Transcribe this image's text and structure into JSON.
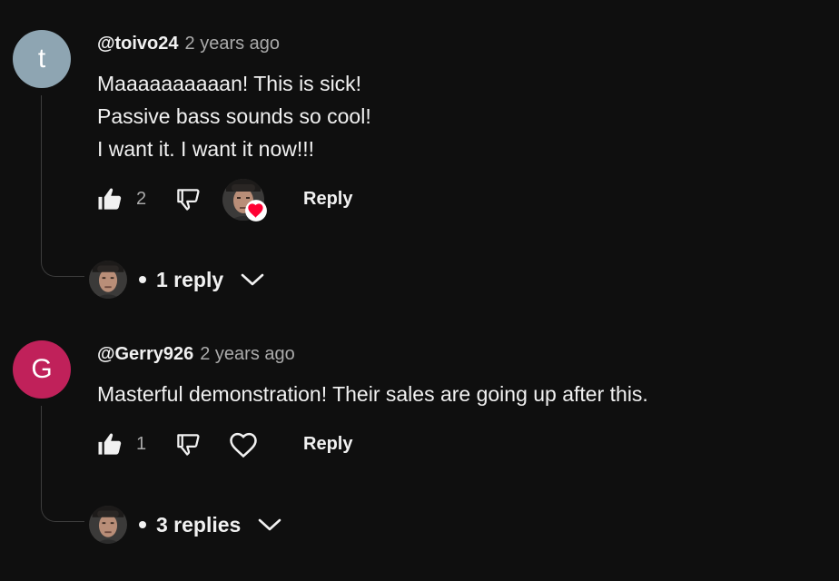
{
  "comments": [
    {
      "author": "@toivo24",
      "time": "2 years ago",
      "avatar_letter": "t",
      "avatar_color": "#8ea5b2",
      "lines": [
        "Maaaaaaaaaan! This is sick!",
        "Passive bass sounds so cool!",
        "I want it. I want it now!!!"
      ],
      "like_count": "2",
      "reply_label": "Reply",
      "hearted_by_creator": true,
      "replies_label": "1 reply"
    },
    {
      "author": "@Gerry926",
      "time": "2 years ago",
      "avatar_letter": "G",
      "avatar_color": "#c0215a",
      "lines": [
        "Masterful demonstration! Their sales are going up after this."
      ],
      "like_count": "1",
      "reply_label": "Reply",
      "hearted_by_creator": false,
      "replies_label": "3 replies"
    }
  ],
  "icons": {
    "like": "thumb-up-icon",
    "dislike": "thumb-down-icon",
    "heart": "heart-icon",
    "chevron": "chevron-down-icon"
  },
  "colors": {
    "background": "#0f0f0f",
    "text_primary": "#f1f1f1",
    "text_secondary": "#aaaaaa",
    "heart_badge": "#ff0033"
  }
}
